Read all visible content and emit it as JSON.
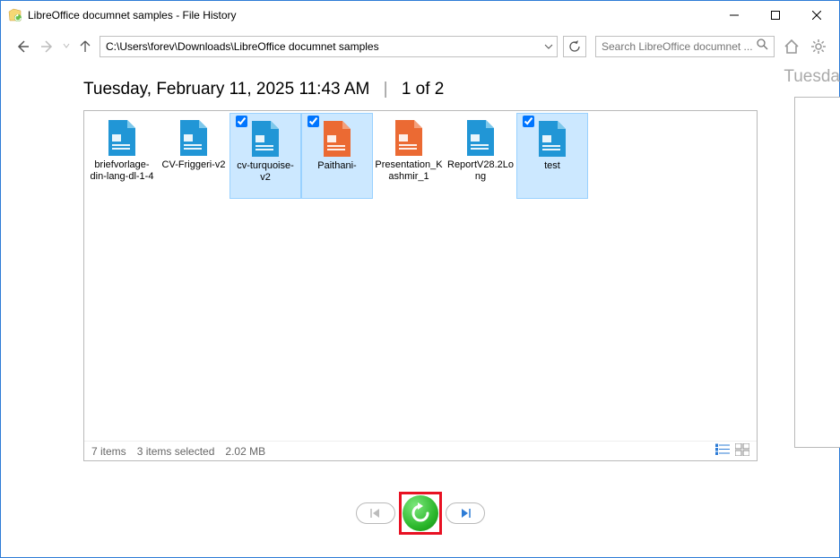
{
  "window": {
    "title": "LibreOffice documnet samples - File History"
  },
  "toolbar": {
    "path": "C:\\Users\\forev\\Downloads\\LibreOffice documnet samples",
    "search_placeholder": "Search LibreOffice documnet ..."
  },
  "timestamp": {
    "label": "Tuesday, February 11, 2025 11:43 AM",
    "page": "1 of 2",
    "next_preview": "Tuesda"
  },
  "files": [
    {
      "name": "briefvorlage-din-lang-dl-1-4",
      "selected": false,
      "color": "blue"
    },
    {
      "name": "CV-Friggeri-v2",
      "selected": false,
      "color": "blue"
    },
    {
      "name": "cv-turquoise-v2",
      "selected": true,
      "color": "blue"
    },
    {
      "name": "Paithani-",
      "selected": true,
      "color": "orange"
    },
    {
      "name": "Presentation_Kashmir_1",
      "selected": false,
      "color": "orange"
    },
    {
      "name": "ReportV28.2Long",
      "selected": false,
      "color": "blue"
    },
    {
      "name": "test",
      "selected": true,
      "color": "blue"
    }
  ],
  "status": {
    "count": "7 items",
    "selection": "3 items selected",
    "size": "2.02 MB"
  }
}
